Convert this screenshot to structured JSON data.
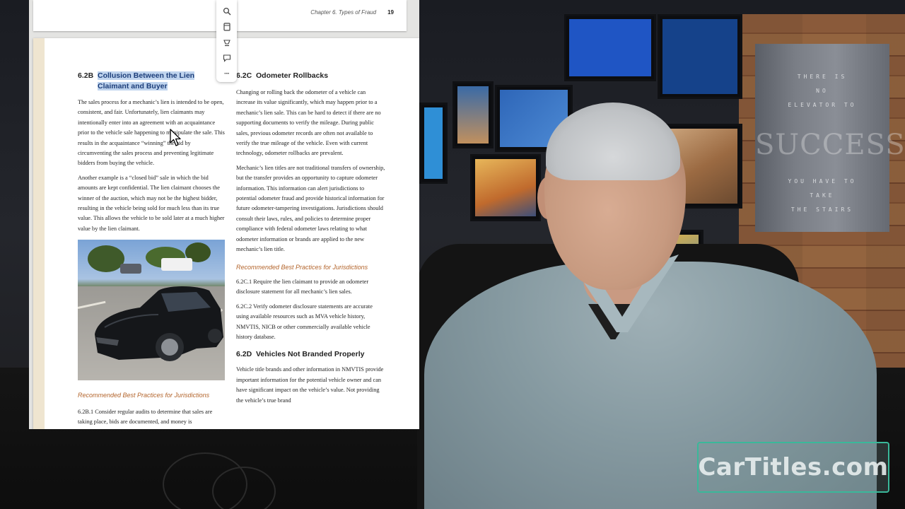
{
  "document": {
    "running_header": {
      "chapter": "Chapter 6. Types of Fraud",
      "page_number": "19"
    },
    "left_column": {
      "heading_number": "6.2B",
      "heading_line1": "Collusion Between the Lien",
      "heading_line2": "Claimant and Buyer",
      "para1": "The sales process for a mechanic’s lien is intended to be open, consistent, and fair. Unfortunately, lien claimants may intentionally enter into an agreement with an acquaintance prior to the vehicle sale happening to manipulate the sale. This results in the acquaintance “winning” the bid by circumventing the sales process and preventing legitimate bidders from buying the vehicle.",
      "para2": "Another example is a “closed bid” sale in which the bid amounts are kept confidential. The lien claimant chooses the winner of the auction, which may not be the highest bidder, resulting in the vehicle being sold for much less than its true value. This allows the vehicle to be sold later at a much higher value by the lien claimant.",
      "subheading": "Recommended Best Practices for Jurisdictions",
      "item1": "6.2B.1   Consider regular audits to determine that sales are taking place, bids are documented, and money is"
    },
    "right_column": {
      "heading1_number": "6.2C",
      "heading1_title": "Odometer Rollbacks",
      "para1": "Changing or rolling back the odometer of a vehicle can increase its value significantly, which may happen prior to a mechanic’s lien sale. This can be hard to detect if there are no supporting documents to verify the mileage. During public sales, previous odometer records are often not available to verify the true mileage of the vehicle. Even with current technology, odometer rollbacks are prevalent.",
      "para2": "Mechanic’s lien titles are not traditional transfers of ownership, but the transfer provides an opportunity to capture odometer information. This information can alert jurisdictions to potential odometer fraud and provide historical information for future odometer-tampering investigations. Jurisdictions should consult their laws, rules, and policies to determine proper compliance with federal odometer laws relating to what odometer information or brands are applied to the new mechanic’s lien title.",
      "subheading": "Recommended Best Practices for Jurisdictions",
      "item1": "6.2C.1   Require the lien claimant to provide an odometer disclosure statement for all mechanic’s lien sales.",
      "item2": "6.2C.2   Verify odometer disclosure statements are accurate using available resources such as MVA vehicle history, NMVTIS, NICB or other commercially available vehicle history database.",
      "heading2_number": "6.2D",
      "heading2_title": "Vehicles Not Branded Properly",
      "para3": "Vehicle title brands and other information in NMVTIS provide important information for the potential vehicle owner and can have significant impact on the vehicle’s value. Not providing the vehicle’s true brand"
    }
  },
  "toolbar": {
    "items": [
      {
        "icon": "search-icon"
      },
      {
        "icon": "page-icon"
      },
      {
        "icon": "highlighter-icon"
      },
      {
        "icon": "comment-icon"
      },
      {
        "icon": "more-icon",
        "glyph": "···"
      }
    ]
  },
  "poster": {
    "lines": [
      "THERE IS",
      "NO",
      "ELEVATOR TO",
      "SUCCESS",
      "YOU HAVE TO",
      "TAKE",
      "THE STAIRS"
    ]
  },
  "watermark": {
    "text": "CarTitles.com"
  },
  "colors": {
    "highlight": "#bfd4ee",
    "subheading": "#b3642b",
    "watermark_border": "#3ab89a"
  }
}
